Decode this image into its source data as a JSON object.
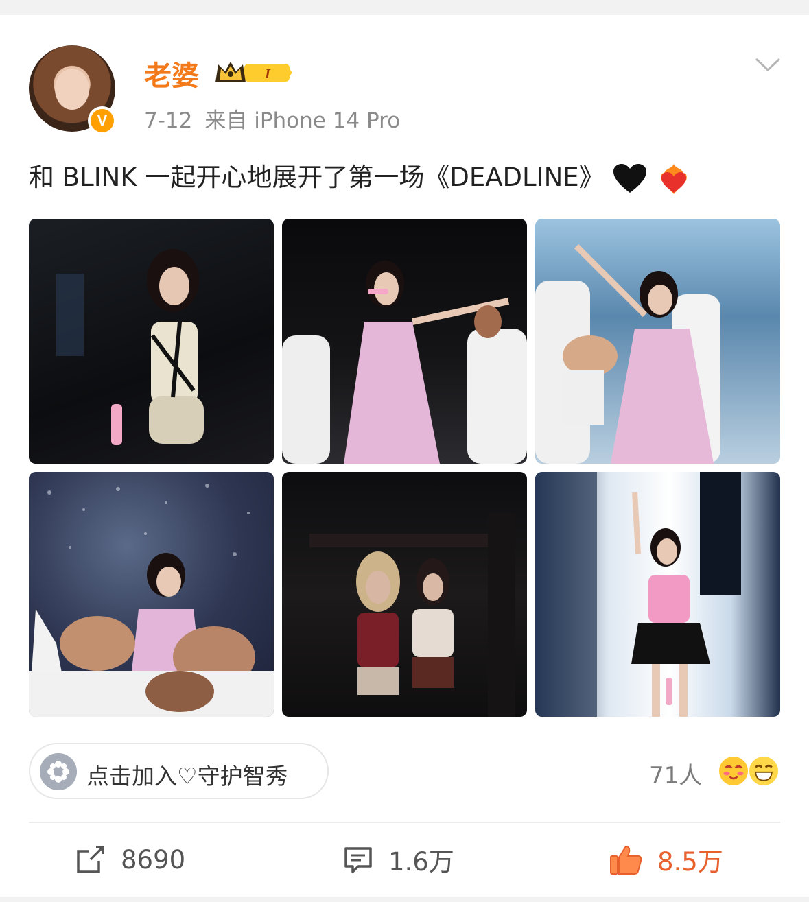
{
  "post": {
    "username": "老婆",
    "membership_badge": "I",
    "date": "7-12",
    "source": "来自 iPhone 14 Pro",
    "verified_badge": "V",
    "text": "和 BLINK 一起开心地展开了第一场《DEADLINE》",
    "emojis": [
      "black-heart-icon",
      "heart-on-fire-icon"
    ]
  },
  "photos": [
    {
      "name": "photo-1"
    },
    {
      "name": "photo-2"
    },
    {
      "name": "photo-3"
    },
    {
      "name": "photo-4"
    },
    {
      "name": "photo-5"
    },
    {
      "name": "photo-6"
    }
  ],
  "join": {
    "label": "点击加入♡守护智秀",
    "people_count": "71人"
  },
  "actions": {
    "repost_count": "8690",
    "comment_count": "1.6万",
    "like_count": "8.5万"
  },
  "colors": {
    "username": "#f27a1a",
    "like_active": "#e8612c",
    "meta_gray": "#8a8a8a"
  }
}
